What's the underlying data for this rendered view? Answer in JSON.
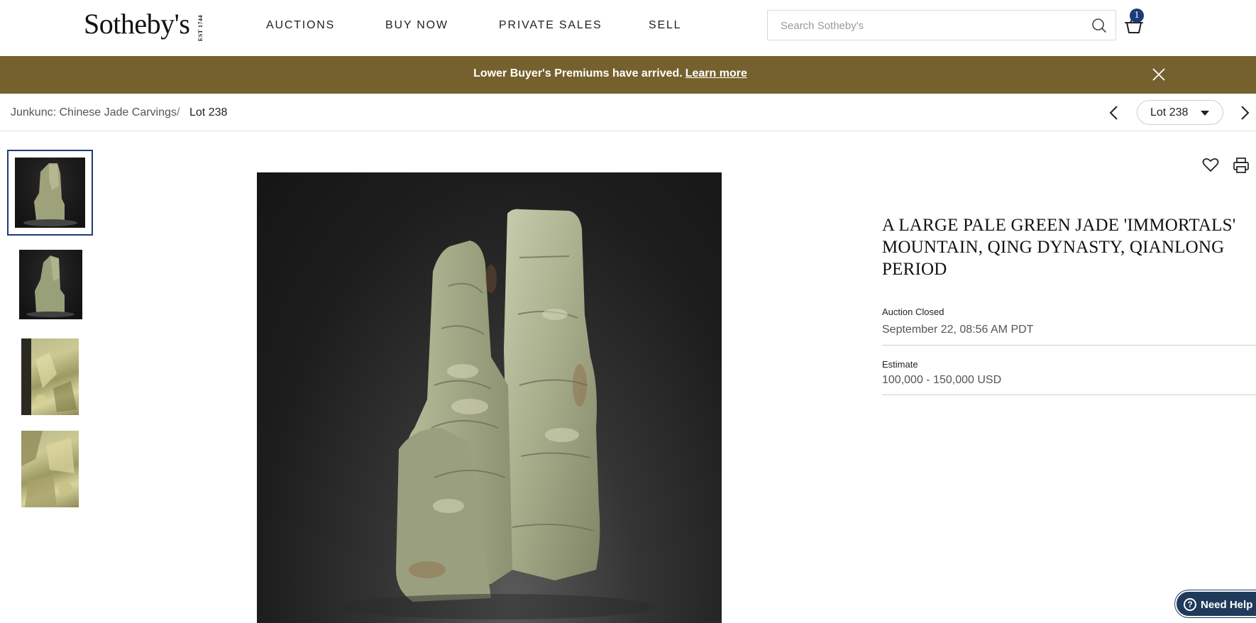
{
  "header": {
    "logo": "Sotheby's",
    "logo_est": "EST 1744",
    "nav": [
      {
        "label": "AUCTIONS"
      },
      {
        "label": "BUY NOW"
      },
      {
        "label": "PRIVATE SALES"
      },
      {
        "label": "SELL"
      }
    ],
    "search": {
      "placeholder": "Search Sotheby's",
      "value": "",
      "icon": "search-icon"
    },
    "cart": {
      "icon": "basket-icon",
      "count": "1"
    }
  },
  "banner": {
    "text": "Lower Buyer's Premiums have arrived.",
    "link": "Learn more",
    "close_icon": "close-icon",
    "color": "#75612e"
  },
  "breadcrumb": {
    "parent": "Junkunc: Chinese Jade Carvings",
    "separator": "/",
    "current": "Lot 238"
  },
  "lot_nav": {
    "selected": "Lot 238",
    "prev_icon": "chevron-left-icon",
    "next_icon": "chevron-right-icon"
  },
  "thumbnails": [
    {
      "name": "thumbnail-1",
      "active": true
    },
    {
      "name": "thumbnail-2",
      "active": false
    },
    {
      "name": "thumbnail-3",
      "active": false
    },
    {
      "name": "thumbnail-4",
      "active": false
    }
  ],
  "lot": {
    "title_lines": [
      "A LARGE PALE GREEN JADE 'IMMORTALS'",
      "MOUNTAIN, QING DYNASTY, QIANLONG",
      "PERIOD"
    ],
    "auction_status_label": "Auction Closed",
    "auction_closed_date": "September 22, 08:56 AM PDT",
    "estimate_label": "Estimate",
    "estimate_value": "100,000 - 150,000 USD"
  },
  "actions": {
    "favorite_icon": "heart-icon",
    "print_icon": "printer-icon"
  },
  "help": {
    "label": "Need Help",
    "icon": "question-circle-icon"
  },
  "colors": {
    "accent": "#1f3a7a",
    "banner": "#75612e"
  }
}
